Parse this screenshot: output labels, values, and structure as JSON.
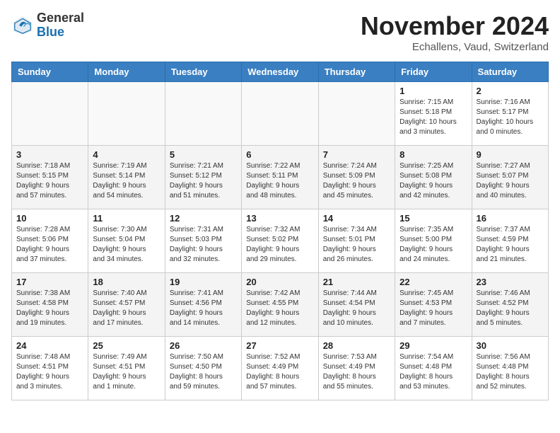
{
  "header": {
    "logo_line1": "General",
    "logo_line2": "Blue",
    "month_title": "November 2024",
    "location": "Echallens, Vaud, Switzerland"
  },
  "days_of_week": [
    "Sunday",
    "Monday",
    "Tuesday",
    "Wednesday",
    "Thursday",
    "Friday",
    "Saturday"
  ],
  "weeks": [
    [
      {
        "day": "",
        "info": ""
      },
      {
        "day": "",
        "info": ""
      },
      {
        "day": "",
        "info": ""
      },
      {
        "day": "",
        "info": ""
      },
      {
        "day": "",
        "info": ""
      },
      {
        "day": "1",
        "info": "Sunrise: 7:15 AM\nSunset: 5:18 PM\nDaylight: 10 hours\nand 3 minutes."
      },
      {
        "day": "2",
        "info": "Sunrise: 7:16 AM\nSunset: 5:17 PM\nDaylight: 10 hours\nand 0 minutes."
      }
    ],
    [
      {
        "day": "3",
        "info": "Sunrise: 7:18 AM\nSunset: 5:15 PM\nDaylight: 9 hours\nand 57 minutes."
      },
      {
        "day": "4",
        "info": "Sunrise: 7:19 AM\nSunset: 5:14 PM\nDaylight: 9 hours\nand 54 minutes."
      },
      {
        "day": "5",
        "info": "Sunrise: 7:21 AM\nSunset: 5:12 PM\nDaylight: 9 hours\nand 51 minutes."
      },
      {
        "day": "6",
        "info": "Sunrise: 7:22 AM\nSunset: 5:11 PM\nDaylight: 9 hours\nand 48 minutes."
      },
      {
        "day": "7",
        "info": "Sunrise: 7:24 AM\nSunset: 5:09 PM\nDaylight: 9 hours\nand 45 minutes."
      },
      {
        "day": "8",
        "info": "Sunrise: 7:25 AM\nSunset: 5:08 PM\nDaylight: 9 hours\nand 42 minutes."
      },
      {
        "day": "9",
        "info": "Sunrise: 7:27 AM\nSunset: 5:07 PM\nDaylight: 9 hours\nand 40 minutes."
      }
    ],
    [
      {
        "day": "10",
        "info": "Sunrise: 7:28 AM\nSunset: 5:06 PM\nDaylight: 9 hours\nand 37 minutes."
      },
      {
        "day": "11",
        "info": "Sunrise: 7:30 AM\nSunset: 5:04 PM\nDaylight: 9 hours\nand 34 minutes."
      },
      {
        "day": "12",
        "info": "Sunrise: 7:31 AM\nSunset: 5:03 PM\nDaylight: 9 hours\nand 32 minutes."
      },
      {
        "day": "13",
        "info": "Sunrise: 7:32 AM\nSunset: 5:02 PM\nDaylight: 9 hours\nand 29 minutes."
      },
      {
        "day": "14",
        "info": "Sunrise: 7:34 AM\nSunset: 5:01 PM\nDaylight: 9 hours\nand 26 minutes."
      },
      {
        "day": "15",
        "info": "Sunrise: 7:35 AM\nSunset: 5:00 PM\nDaylight: 9 hours\nand 24 minutes."
      },
      {
        "day": "16",
        "info": "Sunrise: 7:37 AM\nSunset: 4:59 PM\nDaylight: 9 hours\nand 21 minutes."
      }
    ],
    [
      {
        "day": "17",
        "info": "Sunrise: 7:38 AM\nSunset: 4:58 PM\nDaylight: 9 hours\nand 19 minutes."
      },
      {
        "day": "18",
        "info": "Sunrise: 7:40 AM\nSunset: 4:57 PM\nDaylight: 9 hours\nand 17 minutes."
      },
      {
        "day": "19",
        "info": "Sunrise: 7:41 AM\nSunset: 4:56 PM\nDaylight: 9 hours\nand 14 minutes."
      },
      {
        "day": "20",
        "info": "Sunrise: 7:42 AM\nSunset: 4:55 PM\nDaylight: 9 hours\nand 12 minutes."
      },
      {
        "day": "21",
        "info": "Sunrise: 7:44 AM\nSunset: 4:54 PM\nDaylight: 9 hours\nand 10 minutes."
      },
      {
        "day": "22",
        "info": "Sunrise: 7:45 AM\nSunset: 4:53 PM\nDaylight: 9 hours\nand 7 minutes."
      },
      {
        "day": "23",
        "info": "Sunrise: 7:46 AM\nSunset: 4:52 PM\nDaylight: 9 hours\nand 5 minutes."
      }
    ],
    [
      {
        "day": "24",
        "info": "Sunrise: 7:48 AM\nSunset: 4:51 PM\nDaylight: 9 hours\nand 3 minutes."
      },
      {
        "day": "25",
        "info": "Sunrise: 7:49 AM\nSunset: 4:51 PM\nDaylight: 9 hours\nand 1 minute."
      },
      {
        "day": "26",
        "info": "Sunrise: 7:50 AM\nSunset: 4:50 PM\nDaylight: 8 hours\nand 59 minutes."
      },
      {
        "day": "27",
        "info": "Sunrise: 7:52 AM\nSunset: 4:49 PM\nDaylight: 8 hours\nand 57 minutes."
      },
      {
        "day": "28",
        "info": "Sunrise: 7:53 AM\nSunset: 4:49 PM\nDaylight: 8 hours\nand 55 minutes."
      },
      {
        "day": "29",
        "info": "Sunrise: 7:54 AM\nSunset: 4:48 PM\nDaylight: 8 hours\nand 53 minutes."
      },
      {
        "day": "30",
        "info": "Sunrise: 7:56 AM\nSunset: 4:48 PM\nDaylight: 8 hours\nand 52 minutes."
      }
    ]
  ]
}
